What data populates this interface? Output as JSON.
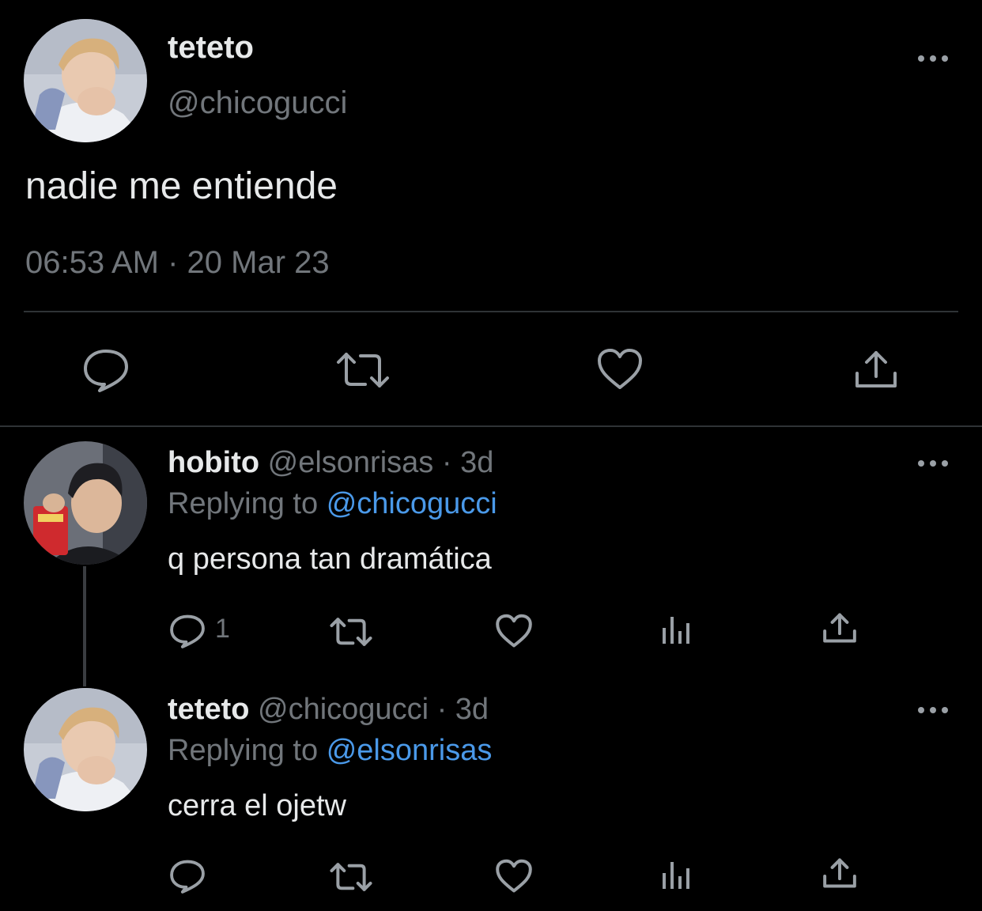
{
  "main_tweet": {
    "display_name": "teteto",
    "handle": "@chicogucci",
    "text": "nadie me entiende",
    "timestamp": "06:53 AM · 20 Mar 23",
    "more_icon": "more-dots-icon",
    "actions": [
      "reply-icon",
      "retweet-icon",
      "like-icon",
      "share-icon"
    ]
  },
  "replies": [
    {
      "display_name": "hobito",
      "handle": "@elsonrisas",
      "separator": "·",
      "age": "3d",
      "replying_label": "Replying to",
      "replying_to": "@chicogucci",
      "text": "q persona tan dramática",
      "reply_count": "1"
    },
    {
      "display_name": "teteto",
      "handle": "@chicogucci",
      "separator": "·",
      "age": "3d",
      "replying_label": "Replying to",
      "replying_to": "@elsonrisas",
      "text": "cerra el ojetw",
      "reply_count": ""
    }
  ],
  "colors": {
    "background": "#000000",
    "text": "#e7e9ea",
    "muted": "#71767b",
    "link": "#4a99e9",
    "divider": "#2f3336"
  }
}
